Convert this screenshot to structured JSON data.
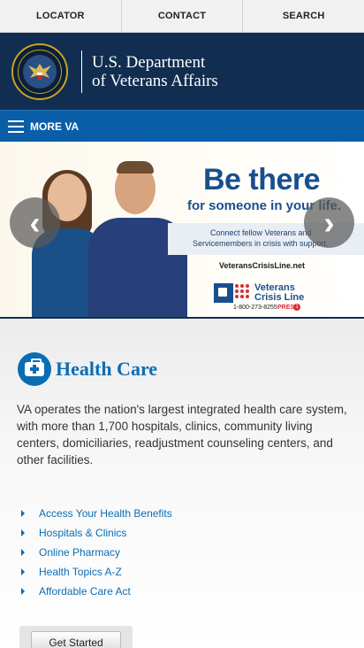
{
  "topnav": {
    "items": [
      "LOCATOR",
      "CONTACT",
      "SEARCH"
    ]
  },
  "header": {
    "line1": "U.S. Department",
    "line2": "of Veterans Affairs",
    "seal_icon": "va-seal-icon"
  },
  "morebar": {
    "label": "MORE VA",
    "icon": "hamburger-icon"
  },
  "hero": {
    "title": "Be there",
    "subtitle": "for someone in your life.",
    "line1": "Connect fellow Veterans and",
    "line2": "Servicemembers in crisis with support.",
    "url": "VeteransCrisisLine.net",
    "logo_line1": "Veterans",
    "logo_line2": "Crisis Line",
    "phone": "1-800-273-8255",
    "press": "PRESS",
    "press_num": "1"
  },
  "carousel": {
    "prev": "‹",
    "next": "›"
  },
  "section": {
    "title": "Health Care",
    "icon": "medical-kit-icon",
    "description": "VA operates the nation's largest integrated health care system, with more than 1,700 hospitals, clinics, community living centers, domiciliaries, readjustment counseling centers, and other facilities.",
    "links": [
      "Access Your Health Benefits",
      "Hospitals & Clinics",
      "Online Pharmacy",
      "Health Topics A-Z",
      "Affordable Care Act"
    ],
    "button": "Get Started"
  },
  "colors": {
    "navy": "#112e51",
    "blue": "#0a5ea8",
    "link": "#0a6db3"
  }
}
